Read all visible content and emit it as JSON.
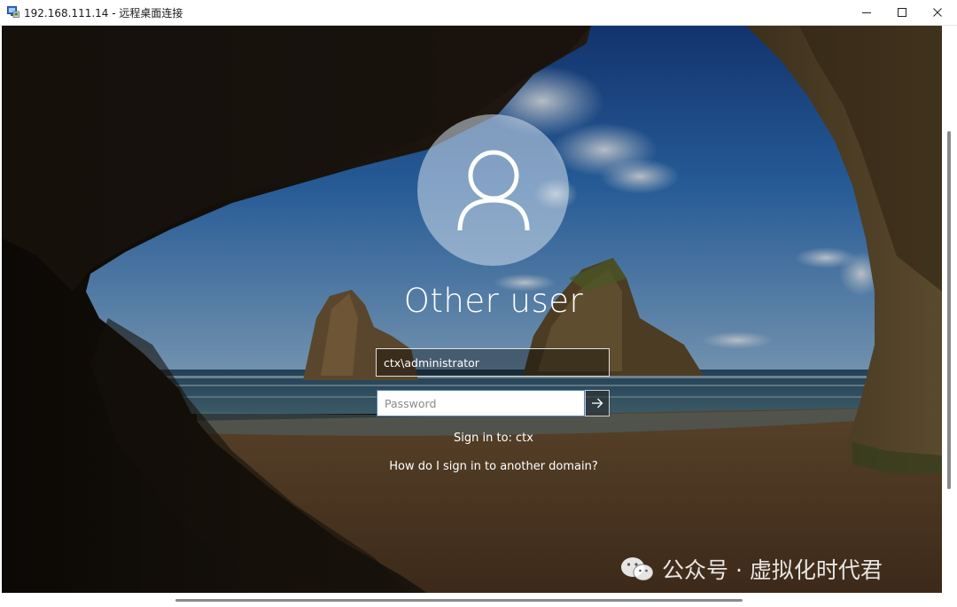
{
  "window": {
    "title": "192.168.111.14 - 远程桌面连接",
    "icon": "remote-desktop-icon",
    "controls": [
      "minimize-icon",
      "maximize-icon",
      "close-icon"
    ]
  },
  "login": {
    "avatar_icon": "user-icon",
    "user_display_name": "Other user",
    "username_value": "ctx\\administrator",
    "password_placeholder": "Password",
    "submit_icon": "arrow-right-icon",
    "sign_in_to": "Sign in to: ctx",
    "other_domain_link": "How do I sign in to another domain?"
  },
  "watermark": {
    "icon": "wechat-icon",
    "text": "公众号 · 虚拟化时代君"
  },
  "colors": {
    "titlebar_bg": "#ffffff",
    "password_border": "#5a7fb5",
    "text_light": "#ffffff"
  }
}
